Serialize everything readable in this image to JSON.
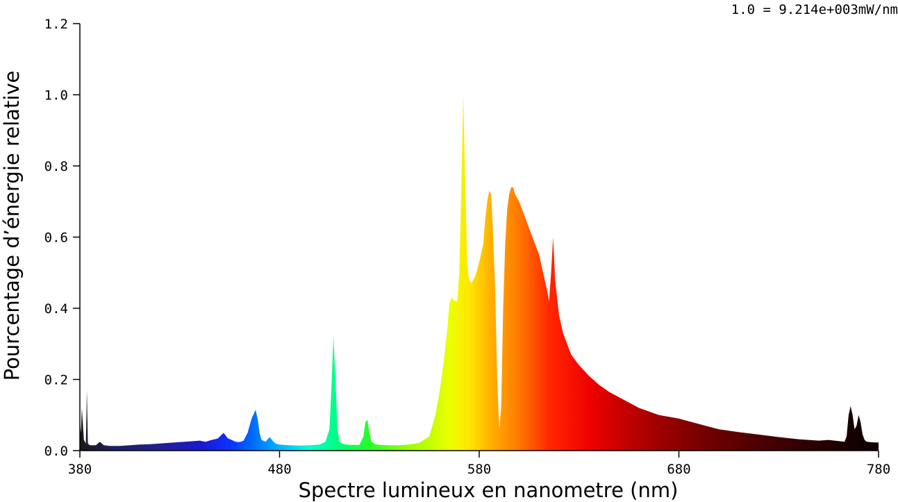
{
  "chart_data": {
    "type": "area",
    "title": "",
    "scale_note": "1.0 = 9.214e+003mW/nm",
    "xlabel": "Spectre lumineux en nanometre (nm)",
    "ylabel": "Pourcentage d’énergie relative",
    "xlim": [
      380,
      780
    ],
    "ylim": [
      0.0,
      1.2
    ],
    "xticks": [
      "380",
      "480",
      "580",
      "680",
      "780"
    ],
    "yticks": [
      "0.0",
      "0.2",
      "0.4",
      "0.6",
      "0.8",
      "1.0",
      "1.2"
    ],
    "grid": false,
    "fill": "wavelength-colored spectrum",
    "series": [
      {
        "x": [
          380,
          380.5,
          381,
          382,
          383,
          383.5,
          384,
          385,
          386,
          388,
          390,
          392,
          395,
          400,
          405,
          410,
          415,
          420,
          425,
          430,
          435,
          440,
          443,
          446,
          449,
          452,
          454,
          456,
          458,
          460,
          462,
          464,
          466,
          468,
          469,
          470,
          471,
          473,
          475,
          477,
          478,
          479,
          480,
          482,
          485,
          490,
          495,
          500,
          503,
          505,
          506,
          507,
          508,
          509,
          510,
          512,
          515,
          520,
          522,
          523,
          524,
          525,
          526,
          528,
          530,
          535,
          540,
          545,
          550,
          555,
          558,
          560,
          562,
          564,
          565,
          566,
          568,
          569,
          570,
          571,
          572,
          573,
          574,
          575,
          576,
          578,
          580,
          582,
          583,
          584,
          585,
          586,
          587,
          588,
          589,
          590,
          591,
          592,
          593,
          594,
          595,
          596,
          597,
          598,
          600,
          602,
          604,
          606,
          608,
          610,
          612,
          614,
          615,
          616,
          617,
          618,
          620,
          622,
          624,
          626,
          630,
          635,
          640,
          645,
          650,
          655,
          660,
          665,
          670,
          675,
          680,
          690,
          700,
          710,
          720,
          730,
          740,
          750,
          755,
          760,
          763,
          764,
          765,
          766,
          767,
          768,
          769,
          770,
          771,
          772,
          773,
          774,
          776,
          778,
          780
        ],
        "values": [
          0.08,
          0.05,
          0.12,
          0.03,
          0.02,
          0.17,
          0.02,
          0.015,
          0.015,
          0.015,
          0.025,
          0.015,
          0.013,
          0.013,
          0.015,
          0.017,
          0.018,
          0.02,
          0.022,
          0.024,
          0.026,
          0.028,
          0.025,
          0.03,
          0.034,
          0.05,
          0.035,
          0.03,
          0.025,
          0.024,
          0.028,
          0.05,
          0.09,
          0.115,
          0.09,
          0.05,
          0.03,
          0.025,
          0.038,
          0.025,
          0.02,
          0.018,
          0.017,
          0.016,
          0.015,
          0.014,
          0.015,
          0.017,
          0.025,
          0.06,
          0.18,
          0.32,
          0.2,
          0.06,
          0.025,
          0.018,
          0.016,
          0.016,
          0.04,
          0.08,
          0.087,
          0.05,
          0.025,
          0.018,
          0.016,
          0.015,
          0.015,
          0.017,
          0.022,
          0.04,
          0.1,
          0.16,
          0.24,
          0.34,
          0.41,
          0.43,
          0.42,
          0.42,
          0.5,
          0.72,
          1.0,
          0.75,
          0.52,
          0.48,
          0.47,
          0.49,
          0.53,
          0.58,
          0.65,
          0.7,
          0.73,
          0.72,
          0.6,
          0.45,
          0.2,
          0.06,
          0.12,
          0.4,
          0.58,
          0.68,
          0.72,
          0.74,
          0.74,
          0.72,
          0.7,
          0.67,
          0.64,
          0.61,
          0.58,
          0.55,
          0.5,
          0.45,
          0.42,
          0.5,
          0.6,
          0.48,
          0.38,
          0.33,
          0.3,
          0.27,
          0.24,
          0.21,
          0.185,
          0.165,
          0.15,
          0.135,
          0.12,
          0.11,
          0.1,
          0.095,
          0.09,
          0.075,
          0.06,
          0.052,
          0.045,
          0.038,
          0.032,
          0.028,
          0.03,
          0.027,
          0.025,
          0.04,
          0.1,
          0.125,
          0.1,
          0.06,
          0.07,
          0.1,
          0.08,
          0.045,
          0.03,
          0.025,
          0.024,
          0.023,
          0.023
        ]
      }
    ]
  }
}
